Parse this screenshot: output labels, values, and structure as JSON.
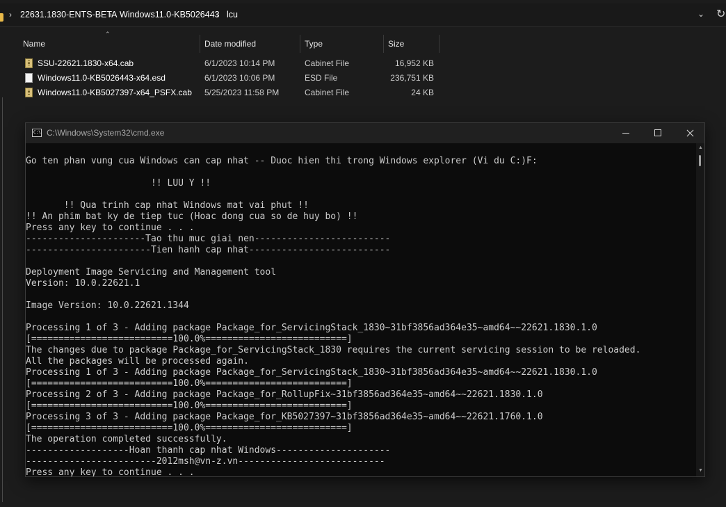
{
  "explorer": {
    "breadcrumb": [
      "22631.1830-ENTS-BETA",
      "Windows11.0-KB5026443",
      "lcu"
    ],
    "breadcrumb_separator": "›",
    "columns": {
      "name": "Name",
      "date": "Date modified",
      "type": "Type",
      "size": "Size"
    },
    "files": [
      {
        "name": "SSU-22621.1830-x64.cab",
        "date": "6/1/2023 10:14 PM",
        "type": "Cabinet File",
        "size": "16,952 KB",
        "icon": "cabinet-file-icon"
      },
      {
        "name": "Windows11.0-KB5026443-x64.esd",
        "date": "6/1/2023 10:06 PM",
        "type": "ESD File",
        "size": "236,751 KB",
        "icon": "document-file-icon"
      },
      {
        "name": "Windows11.0-KB5027397-x64_PSFX.cab",
        "date": "5/25/2023 11:58 PM",
        "type": "Cabinet File",
        "size": "24 KB",
        "icon": "cabinet-file-icon"
      }
    ]
  },
  "cmd": {
    "title": "C:\\Windows\\System32\\cmd.exe",
    "icon_label": "C:\\",
    "lines": [
      "Go ten phan vung cua Windows can cap nhat -- Duoc hien thi trong Windows explorer (Vi du C:)F:",
      "",
      "                       !! LUU Y !!",
      "",
      "       !! Qua trinh cap nhat Windows mat vai phut !!",
      "!! An phim bat ky de tiep tuc (Hoac dong cua so de huy bo) !!",
      "Press any key to continue . . .",
      "----------------------Tao thu muc giai nen-------------------------",
      "-----------------------Tien hanh cap nhat--------------------------",
      "",
      "Deployment Image Servicing and Management tool",
      "Version: 10.0.22621.1",
      "",
      "Image Version: 10.0.22621.1344",
      "",
      "Processing 1 of 3 - Adding package Package_for_ServicingStack_1830~31bf3856ad364e35~amd64~~22621.1830.1.0",
      "[==========================100.0%==========================]",
      "The changes due to package Package_for_ServicingStack_1830 requires the current servicing session to be reloaded.",
      "All the packages will be processed again.",
      "Processing 1 of 3 - Adding package Package_for_ServicingStack_1830~31bf3856ad364e35~amd64~~22621.1830.1.0",
      "[==========================100.0%==========================]",
      "Processing 2 of 3 - Adding package Package_for_RollupFix~31bf3856ad364e35~amd64~~22621.1830.1.0",
      "[==========================100.0%==========================]",
      "Processing 3 of 3 - Adding package Package_for_KB5027397~31bf3856ad364e35~amd64~~22621.1760.1.0",
      "[==========================100.0%==========================]",
      "The operation completed successfully.",
      "-------------------Hoan thanh cap nhat Windows---------------------",
      "------------------------2012msh@vn-z.vn---------------------------",
      "Press any key to continue . . ."
    ]
  },
  "colors": {
    "background": "#1c1c1c",
    "console_bg": "#0c0c0c",
    "console_text": "#cccccc",
    "titlebar": "#202020",
    "folder": "#e9b949"
  }
}
